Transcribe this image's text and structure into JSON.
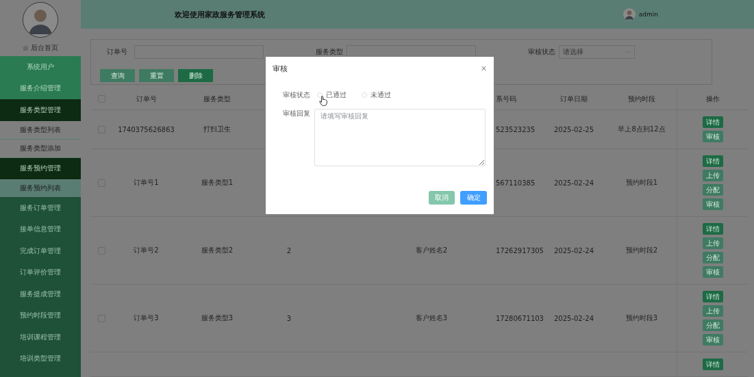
{
  "sidebar": {
    "home": "后台首页",
    "items": [
      {
        "label": "系统用户",
        "highlighted": true,
        "expanded": false
      },
      {
        "label": "服务介绍管理",
        "highlighted": true,
        "expanded": false
      },
      {
        "label": "服务类型管理",
        "highlighted": false,
        "expanded": true,
        "children": [
          {
            "label": "服务类型列表",
            "selected": false
          },
          {
            "label": "服务类型添加",
            "selected": false
          }
        ]
      },
      {
        "label": "服务预约管理",
        "highlighted": false,
        "expanded": true,
        "children": [
          {
            "label": "服务预约列表",
            "selected": true
          }
        ]
      },
      {
        "label": "服务订单管理",
        "highlighted": false,
        "expanded": false
      },
      {
        "label": "接单信息管理",
        "highlighted": false,
        "expanded": false
      },
      {
        "label": "完成订单管理",
        "highlighted": false,
        "expanded": false
      },
      {
        "label": "订单评价管理",
        "highlighted": false,
        "expanded": false
      },
      {
        "label": "服务提成管理",
        "highlighted": false,
        "expanded": false
      },
      {
        "label": "预约时段管理",
        "highlighted": false,
        "expanded": false
      },
      {
        "label": "培训课程管理",
        "highlighted": false,
        "expanded": false
      },
      {
        "label": "培训类型管理",
        "highlighted": false,
        "expanded": false
      }
    ]
  },
  "header": {
    "title": "欢迎使用家政服务管理系统",
    "user": "admin"
  },
  "search": {
    "fields": [
      {
        "label": "订单号",
        "kind": "input"
      },
      {
        "label": "服务类型",
        "kind": "input"
      },
      {
        "label": "审核状态",
        "kind": "select",
        "placeholder": "请选择"
      }
    ],
    "buttons": [
      {
        "label": "查询",
        "kind": "light"
      },
      {
        "label": "重置",
        "kind": "light"
      },
      {
        "label": "删除",
        "kind": "dark"
      }
    ]
  },
  "table": {
    "header_checked": false,
    "columns": [
      "订单号",
      "服务类型",
      "系号码",
      "订单日期",
      "预约时段",
      "操作"
    ],
    "rows": [
      {
        "checked": false,
        "order_no": "1740375626863",
        "service_type": "打扫卫生",
        "phone": "523523235",
        "date": "2025-02-25",
        "slot": "早上8点到12点",
        "actions": [
          {
            "label": "详情",
            "kind": "dark"
          },
          {
            "label": "审核",
            "kind": "light"
          }
        ]
      },
      {
        "checked": false,
        "order_no": "订单号1",
        "service_type": "服务类型1",
        "phone": "567110385",
        "date": "2025-02-24",
        "slot": "预约时段1",
        "actions": [
          {
            "label": "详情",
            "kind": "dark"
          },
          {
            "label": "上传",
            "kind": "light"
          },
          {
            "label": "分配",
            "kind": "light"
          },
          {
            "label": "审核",
            "kind": "light"
          }
        ]
      },
      {
        "checked": false,
        "order_no": "订单号2",
        "service_type": "服务类型2",
        "column_4": "2",
        "column_5": "客户姓名2",
        "phone": "17262917305",
        "date": "2025-02-24",
        "slot": "预约时段2",
        "actions": [
          {
            "label": "详情",
            "kind": "dark"
          },
          {
            "label": "上传",
            "kind": "light"
          },
          {
            "label": "分配",
            "kind": "light"
          },
          {
            "label": "审核",
            "kind": "light"
          }
        ]
      },
      {
        "checked": false,
        "order_no": "订单号3",
        "service_type": "服务类型3",
        "column_4": "3",
        "column_5": "客户姓名3",
        "phone": "17280671103",
        "date": "2025-02-24",
        "slot": "预约时段3",
        "actions": [
          {
            "label": "详情",
            "kind": "dark"
          },
          {
            "label": "上传",
            "kind": "light"
          },
          {
            "label": "分配",
            "kind": "light"
          },
          {
            "label": "审核",
            "kind": "light"
          }
        ]
      },
      {
        "actions": [
          {
            "label": "详情",
            "kind": "dark"
          }
        ]
      }
    ]
  },
  "dialog": {
    "title": "审核",
    "close": "✕",
    "status_label": "审核状态",
    "options": [
      {
        "label": "已通过",
        "selected": false
      },
      {
        "label": "未通过",
        "selected": false
      }
    ],
    "reply_label": "审核回复",
    "reply_placeholder": "请填写审核回复",
    "buttons": [
      {
        "label": "取消",
        "kind": "cancel"
      },
      {
        "label": "确定",
        "kind": "confirm"
      }
    ]
  }
}
